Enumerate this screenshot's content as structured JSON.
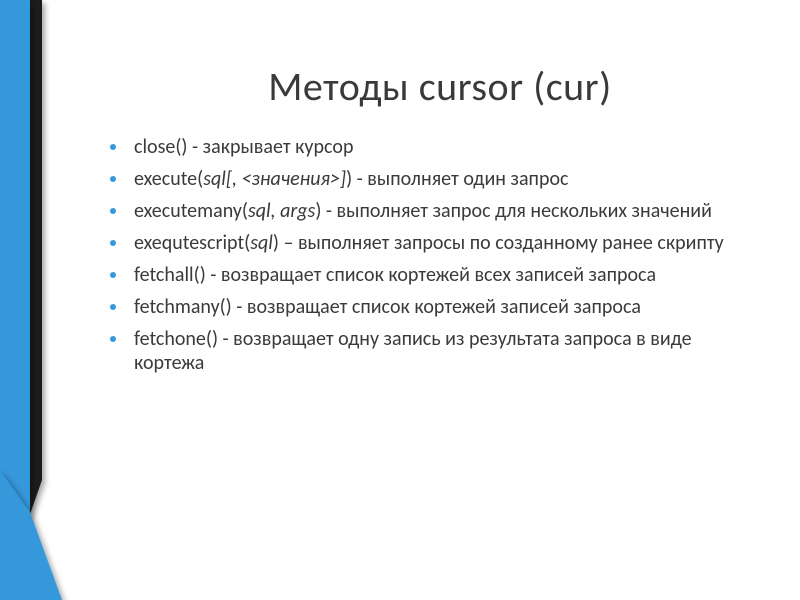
{
  "title": "Методы cursor (cur)",
  "items": [
    {
      "method": "close()",
      "args": "",
      "desc": " - закрывает курсор"
    },
    {
      "method": "execute(",
      "args": "sql[, <значения>]",
      "desc": ") - выполняет один запрос"
    },
    {
      "method": "executemany(",
      "args": "sql, args",
      "desc": ") - выполняет запрос для нескольких значений"
    },
    {
      "method": "exequtescript(",
      "args": "sql",
      "desc": ") – выполняет запросы по созданному ранее скрипту"
    },
    {
      "method": "fetchall()",
      "args": "",
      "desc": " - возвращает список кортежей всех записей запроса"
    },
    {
      "method": "fetchmany()",
      "args": "",
      "desc": " - возвращает список кортежей записей запроса"
    },
    {
      "method": "fetchone()",
      "args": "",
      "desc": " - возвращает одну запись из результата запроса в виде кортежа"
    }
  ]
}
